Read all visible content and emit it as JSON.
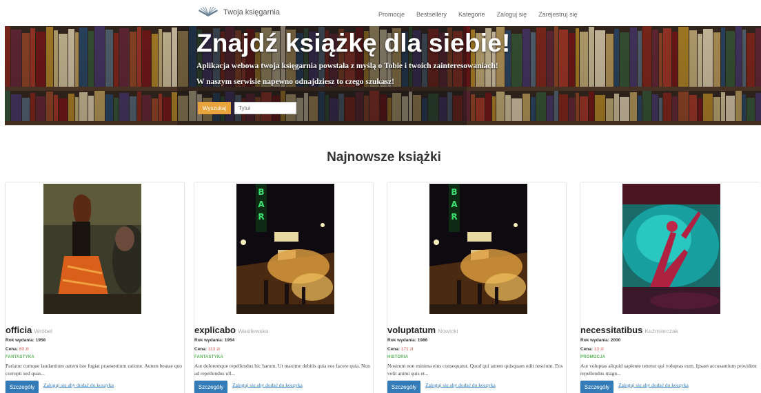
{
  "navbar": {
    "brand": "Twoja księgarnia",
    "links": [
      "Promocje",
      "Bestsellery",
      "Kategorie",
      "Zaloguj się",
      "Zarejestruj się"
    ]
  },
  "hero": {
    "title": "Znajdź książkę dla siebie!",
    "subtitle1": "Aplikacja webowa twoja księgarnia powstała z myślą o Tobie i twoich zainteresowaniach!",
    "subtitle2": "W naszym serwisie napewno odnajdziesz to czego szukasz!",
    "search_button": "Wyszukaj",
    "search_placeholder": "Tytuł"
  },
  "section": {
    "title": "Najnowsze książki"
  },
  "labels": {
    "year": "Rok wydania:",
    "price": "Cena:",
    "currency": "zł",
    "details_button": "Szczegóły",
    "cart_link": "Zaloguj się aby dodać do koszyka"
  },
  "books": [
    {
      "title": "officia",
      "author": "Wróbel",
      "year": "1956",
      "price": "80",
      "category": "FANTASTYKA",
      "description": "Pariatur cumque laudantium autem iste fugiat praesentium ratione. Autem beatae quo corrupti sed quas..."
    },
    {
      "title": "explicabo",
      "author": "Wasilewska",
      "year": "1954",
      "price": "113",
      "category": "FANTASTYKA",
      "description": "Aut doloremque repellendus hic harum. Ut maxime debitis quia eos facere quia. Non ad repellendus ull..."
    },
    {
      "title": "voluptatum",
      "author": "Nowicki",
      "year": "1986",
      "price": "171",
      "category": "HISTORIA",
      "description": "Nostrum non minima eius consequatur. Quod qui autem quisquam odit nesciunt. Eos velit animi quis et..."
    },
    {
      "title": "necessitatibus",
      "author": "Kaźmierczak",
      "year": "2000",
      "price": "13",
      "category": "PROMOCJA",
      "description": "Aut voluptas aliquid sapiente tenetur qui voluptas eum. Ipsam accusantium provident repellendus magn..."
    }
  ],
  "colors": {
    "primary": "#337ab7",
    "search_button": "#e8a33c",
    "category": "#5cb85c",
    "price": "#d9534f"
  }
}
